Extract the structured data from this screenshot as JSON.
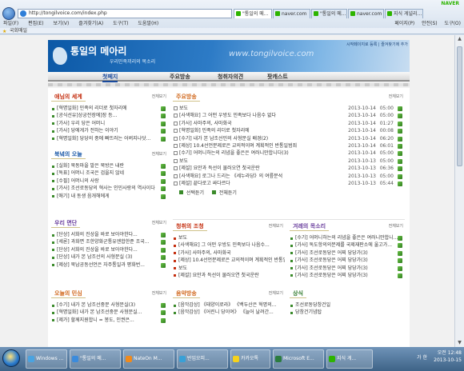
{
  "browser": {
    "address": "http://tongilvoice.com/index.php",
    "tabs": [
      {
        "label": "\"통일의 메...",
        "active": true
      },
      {
        "label": "naver.com",
        "active": false
      },
      {
        "label": "\"통일의 메...",
        "active": false
      },
      {
        "label": "naver.com",
        "active": false
      },
      {
        "label": "지식 게널리...",
        "active": false
      }
    ],
    "corner": "NAVER",
    "menu": [
      "파일(F)",
      "편집(E)",
      "보기(V)",
      "즐겨찾기(A)",
      "도구(T)",
      "도움말(H)"
    ],
    "cmds": [
      "페이지(P)",
      "안전(S)",
      "도구(O)"
    ],
    "favorites": [
      "국회매일"
    ]
  },
  "site": {
    "logo": "통일의 메아리",
    "subtitle": "우리민족끼리의 목소리",
    "url_text": "www.tongilvoice.com",
    "top_links": "시작페이지로 등록 | 즐겨찾기에 추가",
    "nav": [
      {
        "label": "첫페지"
      },
      {
        "label": "주요방송"
      },
      {
        "label": "청취자의견"
      },
      {
        "label": "팟캐스트"
      }
    ],
    "more": "전체보기"
  },
  "sections": {
    "s1": {
      "title": "애님의 세계",
      "items": [
        "[혁명일화] 민족의 리더로 첫자리에",
        "[공식선유]상궁전장에]장 등...",
        "[가사] 우리 당은 어머니",
        "[가사] 당에게가 전하는 이야기",
        "[혁명일화] 당당의 중에 빠뜨러는 어버지나닷..."
      ]
    },
    "s2": {
      "title": "북녘의 오늘",
      "items": [
        "[실화] 북동마을 발은 북방은 내란",
        "[독표] 어머니 조국은 검을지 않네",
        "[수필] 어머니의 사랑",
        "[가사] 조선로동당의 혁사는 인민사랑의 역사이다",
        "[애기] 내 동생 음개해에게"
      ]
    },
    "s3": {
      "title": "우리 면단",
      "items": [
        "[단상] 서화의 진상을 바로 보아야한다...",
        "[세론] 과화면 조한양화군통유엔합한준 조국...",
        "[단상] 서화의 진상을 바로 보아야한다...",
        "[단상] 내가 본 남조선의 사형문실 (3)",
        "[제상] 북남공동선언은 자주통일과 평화번..."
      ]
    },
    "main": {
      "title": "주요방송",
      "items": [
        {
          "text": "보도",
          "date": "2013-10-14",
          "time": "05:00"
        },
        {
          "text": "[사색해요] 그 어떤 우방도 민족보다 나음수 없다",
          "date": "2013-10-14",
          "time": "05:00"
        },
        {
          "text": "[가사] 사마주의, 사마화국",
          "date": "2013-10-14",
          "time": "01:27"
        },
        {
          "text": "[혁명일화] 민족의 리더로 첫자리에",
          "date": "2013-10-14",
          "time": "00:08"
        },
        {
          "text": "[수기] 내가 본 남조선민의 사형문실 배경(2)",
          "date": "2013-10-14",
          "time": "06:20"
        },
        {
          "text": "[제상] 10.4선언분제로은 교의적이며 계획적인 반통일범죄",
          "date": "2013-10-14",
          "time": "06:01"
        },
        {
          "text": "[수기] 어머니하는의 리념을 좋은은 여러니만합니다(3)",
          "date": "2013-10-14",
          "time": "05:00"
        },
        {
          "text": "보도",
          "date": "2013-10-13",
          "time": "05:00"
        },
        {
          "text": "[제설] 요만과 득선이 물러오연 첫국운란",
          "date": "2013-10-13",
          "time": "06:36"
        },
        {
          "text": "[사색해요] 로그나 드리는 《세누라당》의 여릎분석",
          "date": "2013-10-13",
          "time": "05:00"
        },
        {
          "text": "[제설] 끝다로고 싸다르다",
          "date": "2013-10-13",
          "time": "05:44"
        }
      ],
      "select": "선택듣기",
      "all": "전체듣기"
    },
    "s4": {
      "title": "청취의 조청",
      "items": [
        "보도",
        "[사색해요] 그 어떤 우방도 민족보다 나음수...",
        "[가사] 사마주의, 사마화국",
        "[제상] 10.4선언분제로은 교의적이며 계획적인 반통일",
        "보도",
        "[제설] 요만과 득선이 물러오연 첫국운란"
      ]
    },
    "s5": {
      "title": "겨레의 목소리",
      "items": [
        "[수기] 어머니하는의 리념을 좋은은 여러니만합니...",
        "[가사] 독도항의의분제를 국제재판소에 울고가...",
        "[가사] 조선로동당은 어찌 당당가(3)",
        "[가사] 조선로동당은 어찌 당당가(3)",
        "[가사] 조선로동당은 어찌 당당가(3)",
        "[가사] 조선로동당은 어찌 당당가(3)"
      ]
    },
    "s6": {
      "title": "오늘의 민심",
      "items": [
        "[수기] 내가 본 남조선중문 사형문실(3)",
        "[혁명일화] 내가 본 남조선중문 사형문실...",
        "[제가] 할께지원합니 = 봉도, 인권은..."
      ]
    },
    "s7": {
      "title": "음악방송",
      "items": [
        "[음악감상] 《태양이로라》 《백두산은 혁명의...",
        "[음악감상] 《어린니 당이여》 《늘어 날려간..."
      ]
    },
    "s8": {
      "title": "상식",
      "items": [
        "조선로동당창건일",
        "당창건기념탑"
      ]
    }
  },
  "taskbar": {
    "items": [
      {
        "label": "Windows ...",
        "color": "#4aa3e0"
      },
      {
        "label": "\"통일의 메...",
        "color": "#3b8bdc"
      },
      {
        "label": "NateOn M...",
        "color": "#f08a1c"
      },
      {
        "label": "반입오피...",
        "color": "#39a0d6"
      },
      {
        "label": "카카오톡",
        "color": "#f6d21c"
      },
      {
        "label": "Microsoft E...",
        "color": "#2b7c3f"
      },
      {
        "label": "지식 게...",
        "color": "#2db400"
      }
    ],
    "time": "오전 12:48",
    "date": "2013-10-15",
    "lang": "가 한"
  }
}
